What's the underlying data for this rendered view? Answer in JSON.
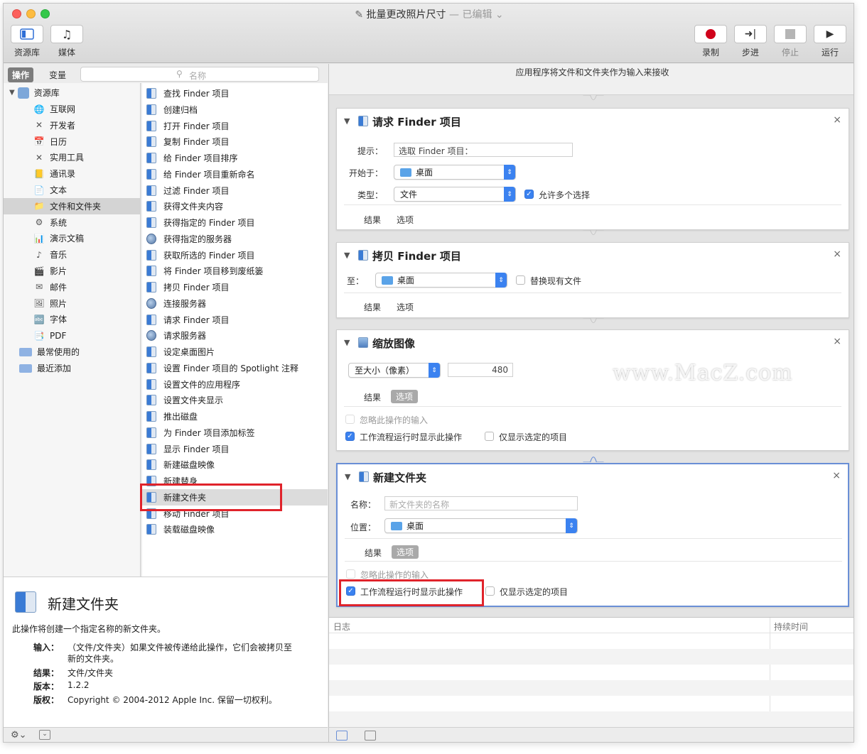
{
  "window": {
    "title": "批量更改照片尺寸",
    "edited": "— 已编辑"
  },
  "toolbar": {
    "library_label": "资源库",
    "media_label": "媒体",
    "record_label": "录制",
    "step_label": "步进",
    "stop_label": "停止",
    "run_label": "运行"
  },
  "leftbar": {
    "actions_tab": "操作",
    "variables_tab": "变量",
    "search_placeholder": "名称"
  },
  "library": {
    "root": "资源库",
    "items": [
      "互联网",
      "开发者",
      "日历",
      "实用工具",
      "通讯录",
      "文本",
      "文件和文件夹",
      "系统",
      "演示文稿",
      "音乐",
      "影片",
      "邮件",
      "照片",
      "字体",
      "PDF"
    ],
    "smart": [
      "最常使用的",
      "最近添加"
    ]
  },
  "actions": [
    "查找 Finder 项目",
    "创建归档",
    "打开 Finder 项目",
    "复制 Finder 项目",
    "给 Finder 项目排序",
    "给 Finder 项目重新命名",
    "过滤 Finder 项目",
    "获得文件夹内容",
    "获得指定的 Finder 项目",
    "获得指定的服务器",
    "获取所选的 Finder 项目",
    "将 Finder 项目移到废纸篓",
    "拷贝 Finder 项目",
    "连接服务器",
    "请求 Finder 项目",
    "请求服务器",
    "设定桌面图片",
    "设置 Finder 项目的 Spotlight 注释",
    "设置文件的应用程序",
    "设置文件夹显示",
    "推出磁盘",
    "为 Finder 项目添加标签",
    "显示 Finder 项目",
    "新建磁盘映像",
    "新建替身",
    "新建文件夹",
    "移动 Finder 项目",
    "装载磁盘映像"
  ],
  "description": {
    "title": "新建文件夹",
    "summary": "此操作将创建一个指定名称的新文件夹。",
    "input_label": "输入：",
    "input_value_1": "（文件/文件夹）如果文件被传递给此操作，它们会被拷贝至",
    "input_value_2": "新的文件夹。",
    "result_label": "结果：",
    "result_value": "文件/文件夹",
    "version_label": "版本：",
    "version_value": "1.2.2",
    "copyright_label": "版权：",
    "copyright_value": "Copyright © 2004-2012 Apple Inc. 保留一切权利。"
  },
  "workflow": {
    "header": "应用程序将文件和文件夹作为输入来接收",
    "card1": {
      "title": "请求 Finder 项目",
      "prompt_label": "提示：",
      "prompt_value": "选取 Finder 项目：",
      "start_label": "开始于：",
      "start_value": "桌面",
      "type_label": "类型：",
      "type_value": "文件",
      "allow_multi": "允许多个选择",
      "result_label": "结果",
      "options_label": "选项"
    },
    "card2": {
      "title": "拷贝 Finder 项目",
      "to_label": "至：",
      "to_value": "桌面",
      "replace_label": "替换现有文件",
      "result_label": "结果",
      "options_label": "选项"
    },
    "card3": {
      "title": "缩放图像",
      "size_value": "至大小（像素）",
      "size_number": "480",
      "result_label": "结果",
      "options_label": "选项",
      "ignore_input": "忽略此操作的输入",
      "show_on_run": "工作流程运行时显示此操作",
      "show_selected": "仅显示选定的项目"
    },
    "card4": {
      "title": "新建文件夹",
      "name_label": "名称：",
      "name_placeholder": "新文件夹的名称",
      "location_label": "位置：",
      "location_value": "桌面",
      "result_label": "结果",
      "options_label": "选项",
      "ignore_input": "忽略此操作的输入",
      "show_on_run": "工作流程运行时显示此操作",
      "show_selected": "仅显示选定的项目"
    },
    "log_label": "日志",
    "duration_label": "持续时间"
  },
  "watermark": "www.MacZ.com",
  "colors": {
    "accent": "#3b82f0",
    "highlight_box": "#e0232b",
    "record": "#d0021b"
  }
}
